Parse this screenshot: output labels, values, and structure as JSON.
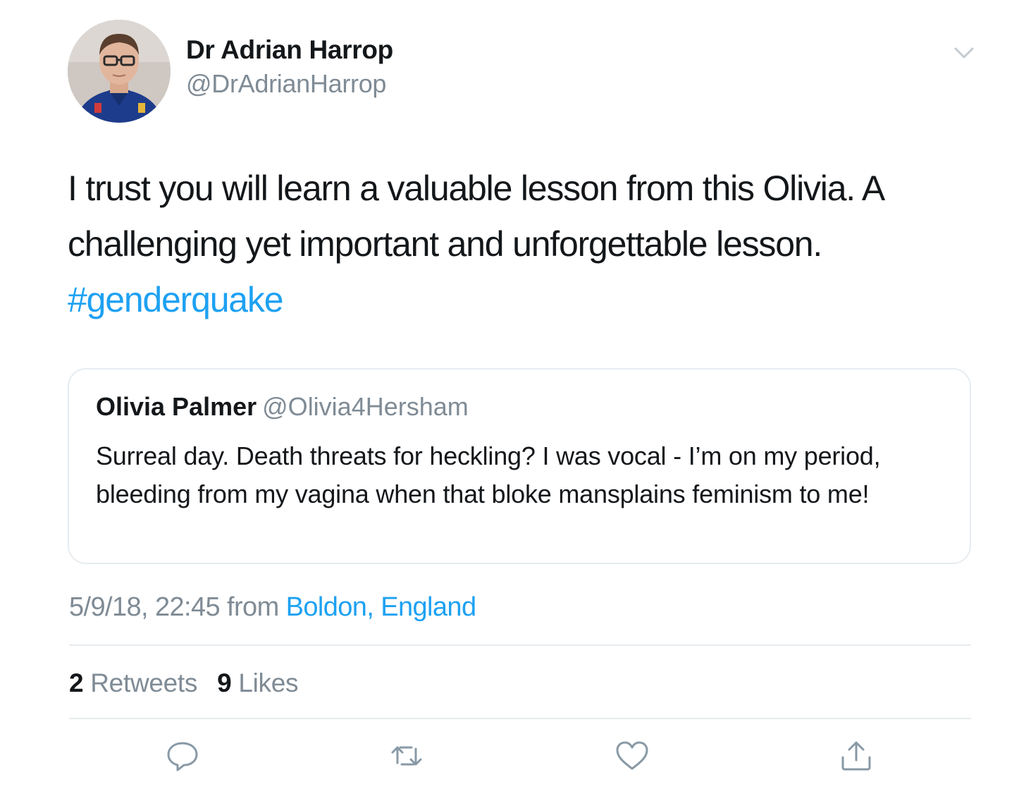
{
  "author": {
    "display_name": "Dr Adrian Harrop",
    "handle": "@DrAdrianHarrop"
  },
  "tweet": {
    "text": "I trust you will learn a valuable lesson from this Olivia. A challenging yet important and unforgettable lesson.",
    "hashtag": "#genderquake"
  },
  "quoted_tweet": {
    "display_name": "Olivia Palmer",
    "handle": "@Olivia4Hersham",
    "text": "Surreal day. Death threats for heckling? I was vocal - I’m on my period, bleeding from my vagina when that bloke mansplains feminism to me!"
  },
  "meta": {
    "timestamp": "5/9/18, 22:45",
    "from_label": "from",
    "location": "Boldon, England"
  },
  "stats": {
    "retweets_count": "2",
    "retweets_label": "Retweets",
    "likes_count": "9",
    "likes_label": "Likes"
  },
  "icons": {
    "reply": "reply-icon",
    "retweet": "retweet-icon",
    "like": "heart-icon",
    "share": "share-icon",
    "menu": "chevron-down-icon"
  },
  "colors": {
    "link": "#1da1f2",
    "secondary_text": "#7f8b95",
    "primary_text": "#14171a",
    "divider": "#e6ecf0"
  }
}
